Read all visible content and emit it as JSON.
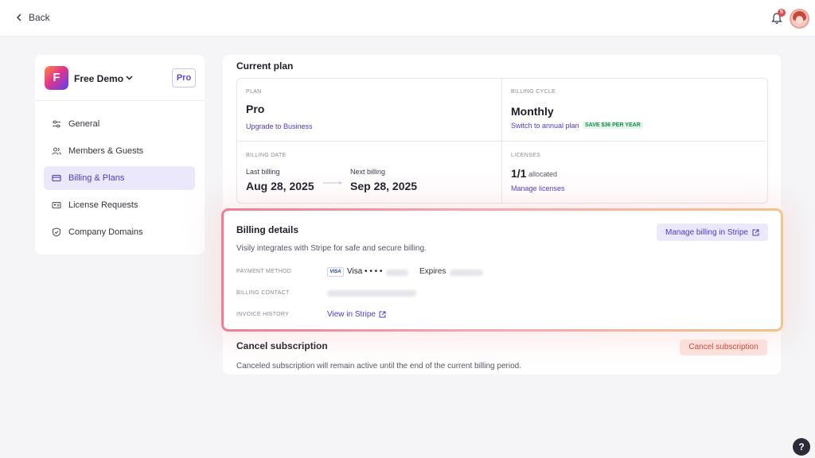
{
  "topbar": {
    "back_label": "Back",
    "notification_count": "5"
  },
  "sidebar": {
    "workspace_initial": "F",
    "workspace_name": "Free Demo",
    "plan_badge": "Pro",
    "items": [
      {
        "label": "General",
        "icon": "sliders-icon",
        "active": false
      },
      {
        "label": "Members & Guests",
        "icon": "users-icon",
        "active": false
      },
      {
        "label": "Billing & Plans",
        "icon": "credit-card-icon",
        "active": true
      },
      {
        "label": "License Requests",
        "icon": "id-card-icon",
        "active": false
      },
      {
        "label": "Company Domains",
        "icon": "shield-icon",
        "active": false
      }
    ]
  },
  "current_plan": {
    "title": "Current plan",
    "plan_caption": "PLAN",
    "plan_value": "Pro",
    "upgrade_link": "Upgrade to Business",
    "cycle_caption": "BILLING CYCLE",
    "cycle_value": "Monthly",
    "switch_link": "Switch to annual plan",
    "save_badge": "SAVE $36 PER YEAR",
    "date_caption": "BILLING DATE",
    "last_label": "Last billing",
    "last_value": "Aug 28, 2025",
    "next_label": "Next billing",
    "next_value": "Sep 28, 2025",
    "licenses_caption": "LICENSES",
    "licenses_value": "1/1",
    "licenses_suffix": "allocated",
    "manage_licenses_link": "Manage licenses"
  },
  "billing_details": {
    "title": "Billing details",
    "manage_button": "Manage billing in Stripe",
    "description": "Visily integrates with Stripe for safe and secure billing.",
    "payment_caption": "PAYMENT METHOD",
    "card_brand_logo": "VISA",
    "card_text": "Visa • • • •",
    "expires_label": "Expires",
    "contact_caption": "BILLING CONTACT",
    "invoice_caption": "INVOICE HISTORY",
    "view_link": "View in Stripe"
  },
  "cancel": {
    "title": "Cancel subscription",
    "button": "Cancel subscription",
    "description": "Canceled subscription will remain active until the end of the current billing period."
  },
  "help_label": "?",
  "colors": {
    "accent": "#4a3cc9",
    "accent_bg": "#ebe8fb",
    "danger": "#c9442d",
    "danger_bg": "#fde4e0",
    "success": "#1f8a4c"
  }
}
